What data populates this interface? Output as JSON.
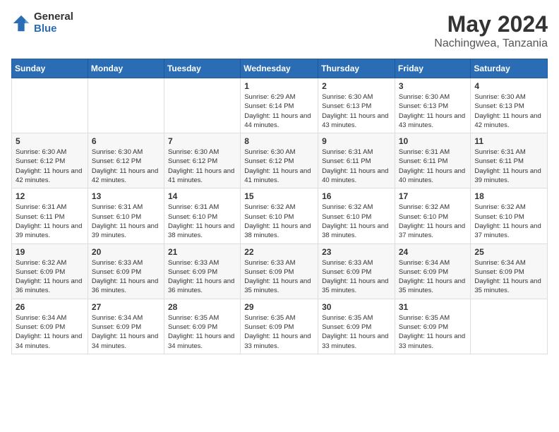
{
  "logo": {
    "general": "General",
    "blue": "Blue"
  },
  "header": {
    "month": "May 2024",
    "location": "Nachingwea, Tanzania"
  },
  "weekdays": [
    "Sunday",
    "Monday",
    "Tuesday",
    "Wednesday",
    "Thursday",
    "Friday",
    "Saturday"
  ],
  "weeks": [
    [
      {
        "day": "",
        "sunrise": "",
        "sunset": "",
        "daylight": ""
      },
      {
        "day": "",
        "sunrise": "",
        "sunset": "",
        "daylight": ""
      },
      {
        "day": "",
        "sunrise": "",
        "sunset": "",
        "daylight": ""
      },
      {
        "day": "1",
        "sunrise": "Sunrise: 6:29 AM",
        "sunset": "Sunset: 6:14 PM",
        "daylight": "Daylight: 11 hours and 44 minutes."
      },
      {
        "day": "2",
        "sunrise": "Sunrise: 6:30 AM",
        "sunset": "Sunset: 6:13 PM",
        "daylight": "Daylight: 11 hours and 43 minutes."
      },
      {
        "day": "3",
        "sunrise": "Sunrise: 6:30 AM",
        "sunset": "Sunset: 6:13 PM",
        "daylight": "Daylight: 11 hours and 43 minutes."
      },
      {
        "day": "4",
        "sunrise": "Sunrise: 6:30 AM",
        "sunset": "Sunset: 6:13 PM",
        "daylight": "Daylight: 11 hours and 42 minutes."
      }
    ],
    [
      {
        "day": "5",
        "sunrise": "Sunrise: 6:30 AM",
        "sunset": "Sunset: 6:12 PM",
        "daylight": "Daylight: 11 hours and 42 minutes."
      },
      {
        "day": "6",
        "sunrise": "Sunrise: 6:30 AM",
        "sunset": "Sunset: 6:12 PM",
        "daylight": "Daylight: 11 hours and 42 minutes."
      },
      {
        "day": "7",
        "sunrise": "Sunrise: 6:30 AM",
        "sunset": "Sunset: 6:12 PM",
        "daylight": "Daylight: 11 hours and 41 minutes."
      },
      {
        "day": "8",
        "sunrise": "Sunrise: 6:30 AM",
        "sunset": "Sunset: 6:12 PM",
        "daylight": "Daylight: 11 hours and 41 minutes."
      },
      {
        "day": "9",
        "sunrise": "Sunrise: 6:31 AM",
        "sunset": "Sunset: 6:11 PM",
        "daylight": "Daylight: 11 hours and 40 minutes."
      },
      {
        "day": "10",
        "sunrise": "Sunrise: 6:31 AM",
        "sunset": "Sunset: 6:11 PM",
        "daylight": "Daylight: 11 hours and 40 minutes."
      },
      {
        "day": "11",
        "sunrise": "Sunrise: 6:31 AM",
        "sunset": "Sunset: 6:11 PM",
        "daylight": "Daylight: 11 hours and 39 minutes."
      }
    ],
    [
      {
        "day": "12",
        "sunrise": "Sunrise: 6:31 AM",
        "sunset": "Sunset: 6:11 PM",
        "daylight": "Daylight: 11 hours and 39 minutes."
      },
      {
        "day": "13",
        "sunrise": "Sunrise: 6:31 AM",
        "sunset": "Sunset: 6:10 PM",
        "daylight": "Daylight: 11 hours and 39 minutes."
      },
      {
        "day": "14",
        "sunrise": "Sunrise: 6:31 AM",
        "sunset": "Sunset: 6:10 PM",
        "daylight": "Daylight: 11 hours and 38 minutes."
      },
      {
        "day": "15",
        "sunrise": "Sunrise: 6:32 AM",
        "sunset": "Sunset: 6:10 PM",
        "daylight": "Daylight: 11 hours and 38 minutes."
      },
      {
        "day": "16",
        "sunrise": "Sunrise: 6:32 AM",
        "sunset": "Sunset: 6:10 PM",
        "daylight": "Daylight: 11 hours and 38 minutes."
      },
      {
        "day": "17",
        "sunrise": "Sunrise: 6:32 AM",
        "sunset": "Sunset: 6:10 PM",
        "daylight": "Daylight: 11 hours and 37 minutes."
      },
      {
        "day": "18",
        "sunrise": "Sunrise: 6:32 AM",
        "sunset": "Sunset: 6:10 PM",
        "daylight": "Daylight: 11 hours and 37 minutes."
      }
    ],
    [
      {
        "day": "19",
        "sunrise": "Sunrise: 6:32 AM",
        "sunset": "Sunset: 6:09 PM",
        "daylight": "Daylight: 11 hours and 36 minutes."
      },
      {
        "day": "20",
        "sunrise": "Sunrise: 6:33 AM",
        "sunset": "Sunset: 6:09 PM",
        "daylight": "Daylight: 11 hours and 36 minutes."
      },
      {
        "day": "21",
        "sunrise": "Sunrise: 6:33 AM",
        "sunset": "Sunset: 6:09 PM",
        "daylight": "Daylight: 11 hours and 36 minutes."
      },
      {
        "day": "22",
        "sunrise": "Sunrise: 6:33 AM",
        "sunset": "Sunset: 6:09 PM",
        "daylight": "Daylight: 11 hours and 35 minutes."
      },
      {
        "day": "23",
        "sunrise": "Sunrise: 6:33 AM",
        "sunset": "Sunset: 6:09 PM",
        "daylight": "Daylight: 11 hours and 35 minutes."
      },
      {
        "day": "24",
        "sunrise": "Sunrise: 6:34 AM",
        "sunset": "Sunset: 6:09 PM",
        "daylight": "Daylight: 11 hours and 35 minutes."
      },
      {
        "day": "25",
        "sunrise": "Sunrise: 6:34 AM",
        "sunset": "Sunset: 6:09 PM",
        "daylight": "Daylight: 11 hours and 35 minutes."
      }
    ],
    [
      {
        "day": "26",
        "sunrise": "Sunrise: 6:34 AM",
        "sunset": "Sunset: 6:09 PM",
        "daylight": "Daylight: 11 hours and 34 minutes."
      },
      {
        "day": "27",
        "sunrise": "Sunrise: 6:34 AM",
        "sunset": "Sunset: 6:09 PM",
        "daylight": "Daylight: 11 hours and 34 minutes."
      },
      {
        "day": "28",
        "sunrise": "Sunrise: 6:35 AM",
        "sunset": "Sunset: 6:09 PM",
        "daylight": "Daylight: 11 hours and 34 minutes."
      },
      {
        "day": "29",
        "sunrise": "Sunrise: 6:35 AM",
        "sunset": "Sunset: 6:09 PM",
        "daylight": "Daylight: 11 hours and 33 minutes."
      },
      {
        "day": "30",
        "sunrise": "Sunrise: 6:35 AM",
        "sunset": "Sunset: 6:09 PM",
        "daylight": "Daylight: 11 hours and 33 minutes."
      },
      {
        "day": "31",
        "sunrise": "Sunrise: 6:35 AM",
        "sunset": "Sunset: 6:09 PM",
        "daylight": "Daylight: 11 hours and 33 minutes."
      },
      {
        "day": "",
        "sunrise": "",
        "sunset": "",
        "daylight": ""
      }
    ]
  ]
}
